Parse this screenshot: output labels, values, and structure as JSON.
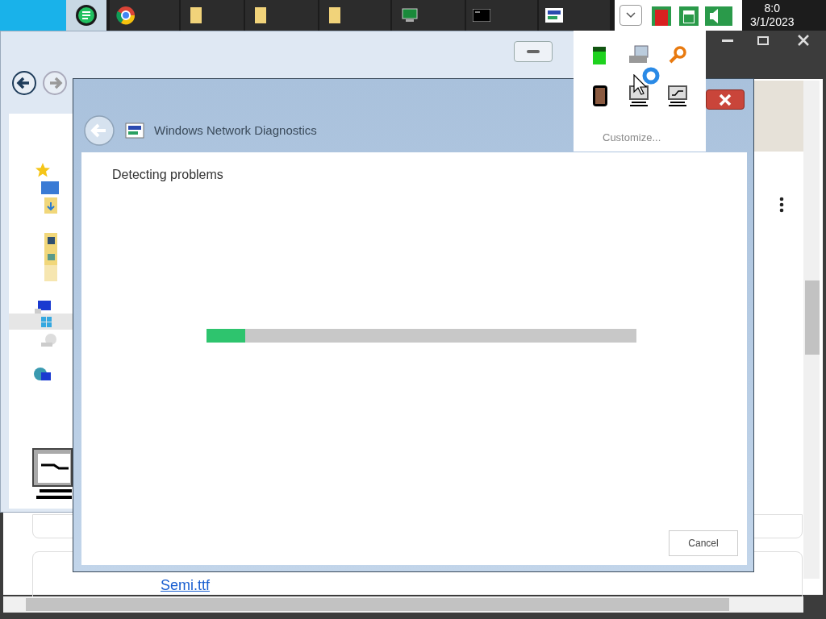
{
  "taskbar": {
    "clock": {
      "time": "8:0",
      "date": "3/1/2023"
    }
  },
  "tray_overflow": {
    "customize": "Customize..."
  },
  "browser": {
    "link": "Semi.ttf"
  },
  "dialog": {
    "title": "Windows Network Diagnostics",
    "heading": "Detecting problems",
    "progress": {
      "level": 0.09
    },
    "cancel": "Cancel"
  }
}
